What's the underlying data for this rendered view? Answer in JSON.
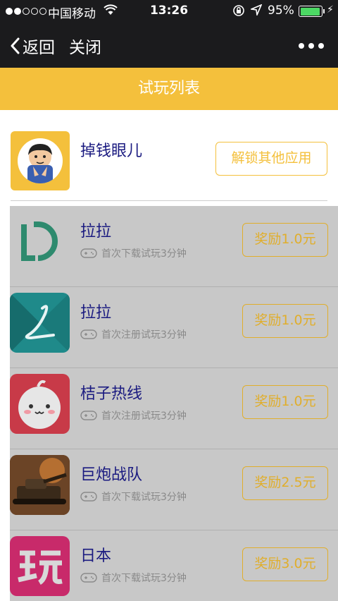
{
  "status": {
    "carrier": "中国移动",
    "time": "13:26",
    "battery_pct": "95%",
    "battery_level": 0.95
  },
  "nav": {
    "back_label": "返回",
    "close_label": "关闭"
  },
  "title": "试玩列表",
  "featured": {
    "name": "掉钱眼儿",
    "unlock_label": "解锁其他应用"
  },
  "apps": [
    {
      "name": "拉拉",
      "subtitle": "首次下载试玩3分钟",
      "reward": "奖励1.0元",
      "icon": "lala-d-logo"
    },
    {
      "name": "拉拉",
      "subtitle": "首次注册试玩3分钟",
      "reward": "奖励1.0元",
      "icon": "lala-l-logo"
    },
    {
      "name": "桔子热线",
      "subtitle": "首次注册试玩3分钟",
      "reward": "奖励1.0元",
      "icon": "juzi-face-logo"
    },
    {
      "name": "巨炮战队",
      "subtitle": "首次下载试玩3分钟",
      "reward": "奖励2.5元",
      "icon": "tank-game-logo"
    },
    {
      "name": "日本",
      "subtitle": "首次下载试玩3分钟",
      "reward": "奖励3.0元",
      "icon": "wan-logo"
    }
  ],
  "colors": {
    "accent": "#f4c03c",
    "dark_bar": "#1b1b1d",
    "name_text": "#1a1a80"
  }
}
